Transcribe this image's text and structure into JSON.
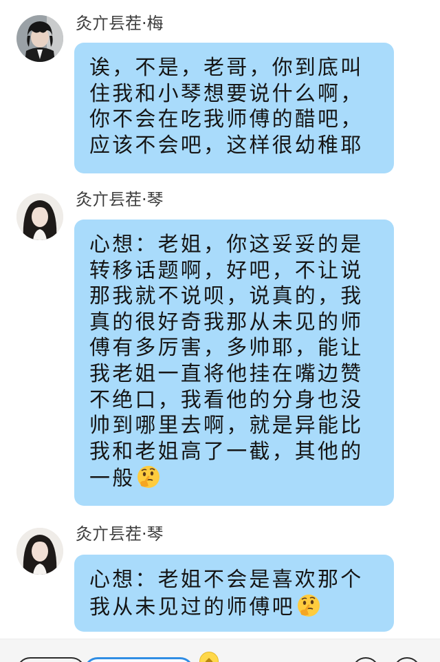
{
  "messages": [
    {
      "sender": "灸亣镸茬·梅",
      "avatar": "avatar-boy-dark-hair",
      "text": "诶，不是，老哥，你到底叫住我和小琴想要说什么啊，你不会在吃我师傅的醋吧，应该不会吧，这样很幼稚耶",
      "emoji": ""
    },
    {
      "sender": "灸亣镸茬·琴",
      "avatar": "avatar-girl-long-hair",
      "text": "心想：老姐，你这妥妥的是转移话题啊，好吧，不让说那我就不说呗，说真的，我真的很好奇我那从未见的师傅有多厉害，多帅耶，能让我老姐一直将他挂在嘴边赞不绝口，我看他的分身也没帅到哪里去啊，就是异能比我和老姐高了一截，其他的一般",
      "emoji": "thinking-face"
    },
    {
      "sender": "灸亣镸茬·琴",
      "avatar": "avatar-girl-long-hair",
      "text": "心想：老姐不会是喜欢那个我从未见过的师傅吧",
      "emoji": "thinking-face"
    }
  ],
  "toolbar": {
    "items": [
      "voice-icon",
      "text-input-pill",
      "coin-icon",
      "emoji-icon",
      "more-icon"
    ]
  },
  "colors": {
    "bubble": "#a9dbfb",
    "background": "#ffffff",
    "text": "#151515",
    "name": "#3c3c3c"
  }
}
